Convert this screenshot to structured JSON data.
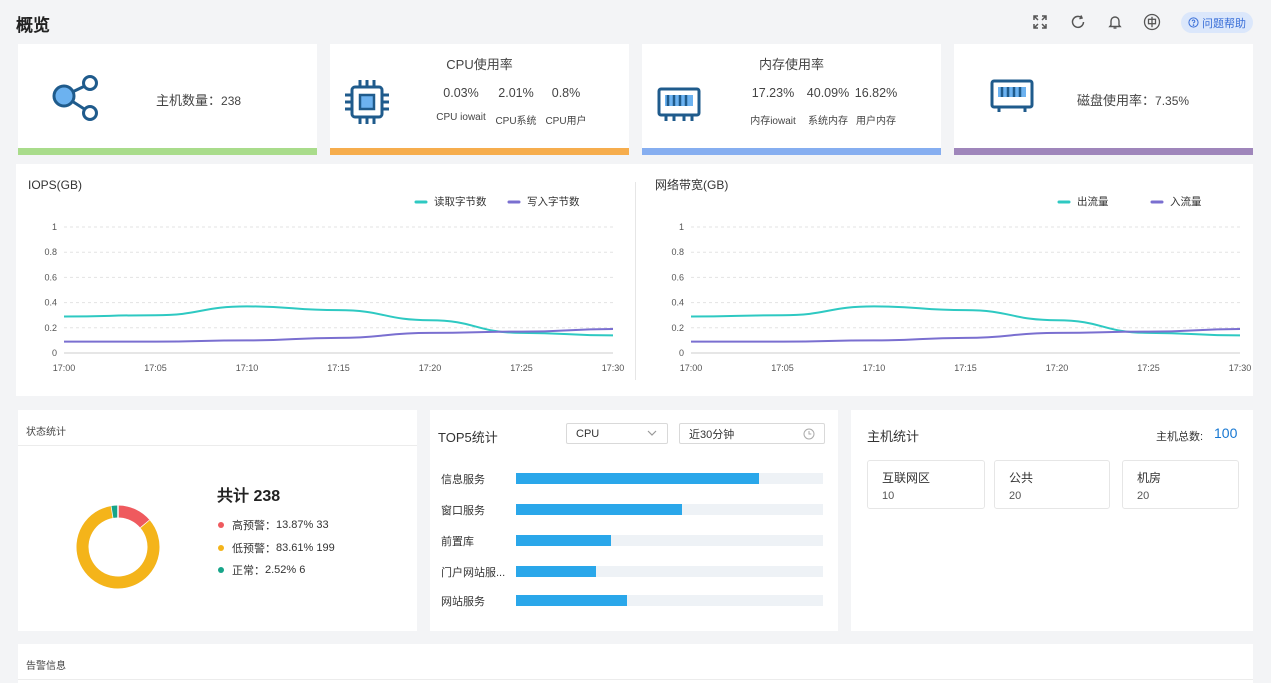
{
  "header": {
    "title": "概览",
    "icons": [
      "fullscreen-icon",
      "refresh-icon",
      "bell-icon",
      "language-icon"
    ],
    "help_label": "问题帮助"
  },
  "stat_cards": {
    "hosts": {
      "label": "主机数量：",
      "value": "238",
      "icon": "share-nodes-icon",
      "color": "#a9dc8b"
    },
    "cpu": {
      "title": "CPU使用率",
      "icon": "cpu-chip-icon",
      "color": "#f6ad4d",
      "metrics": [
        {
          "value": "0.03%",
          "label": "CPU iowait"
        },
        {
          "value": "2.01%",
          "label": "CPU系统"
        },
        {
          "value": "0.8%",
          "label": "CPU用户"
        }
      ]
    },
    "memory": {
      "title": "内存使用率",
      "icon": "memory-icon",
      "color": "#86aef0",
      "metrics": [
        {
          "value": "17.23%",
          "label": "内存iowait"
        },
        {
          "value": "40.09%",
          "label": "系统内存"
        },
        {
          "value": "16.82%",
          "label": "用户内存"
        }
      ]
    },
    "disk": {
      "label": "磁盘使用率：",
      "value": "7.35%",
      "icon": "disk-icon",
      "color": "#9f86bb"
    }
  },
  "colors": {
    "teal": "#2ec9c2",
    "purple": "#7a6fd0",
    "icon_blue": "#1f5b8c",
    "accent_blue": "#1677d2"
  },
  "chart_data": [
    {
      "type": "line",
      "title": "IOPS(GB)",
      "x": [
        "17:00",
        "17:05",
        "17:10",
        "17:15",
        "17:20",
        "17:25",
        "17:30"
      ],
      "ylim": [
        0,
        1
      ],
      "yticks": [
        "0",
        "0.2",
        "0.4",
        "0.6",
        "0.8",
        "1"
      ],
      "grid": true,
      "legend": "top-right",
      "series": [
        {
          "name": "读取字节数",
          "color": "#2ec9c2",
          "values": [
            0.29,
            0.3,
            0.37,
            0.34,
            0.26,
            0.16,
            0.14
          ]
        },
        {
          "name": "写入字节数",
          "color": "#7a6fd0",
          "values": [
            0.09,
            0.09,
            0.1,
            0.12,
            0.16,
            0.17,
            0.19
          ]
        }
      ]
    },
    {
      "type": "line",
      "title": "网络带宽(GB)",
      "x": [
        "17:00",
        "17:05",
        "17:10",
        "17:15",
        "17:20",
        "17:25",
        "17:30"
      ],
      "ylim": [
        0,
        1
      ],
      "yticks": [
        "0",
        "0.2",
        "0.4",
        "0.6",
        "0.8",
        "1"
      ],
      "grid": true,
      "legend": "top-right",
      "series": [
        {
          "name": "出流量",
          "color": "#2ec9c2",
          "values": [
            0.29,
            0.3,
            0.37,
            0.34,
            0.26,
            0.16,
            0.14
          ]
        },
        {
          "name": "入流量",
          "color": "#7a6fd0",
          "values": [
            0.09,
            0.09,
            0.1,
            0.12,
            0.16,
            0.17,
            0.19
          ]
        }
      ]
    },
    {
      "type": "pie",
      "title": "状态统计",
      "total_label": "共计 238",
      "slices": [
        {
          "name": "高预警",
          "percent": "13.87%",
          "count": 33,
          "value": 13.87,
          "color": "#ef5a5e"
        },
        {
          "name": "低预警",
          "percent": "83.61%",
          "count": 199,
          "value": 83.61,
          "color": "#f4b41a"
        },
        {
          "name": "正常",
          "percent": "2.52%",
          "count": 6,
          "value": 2.52,
          "color": "#17a589"
        }
      ]
    },
    {
      "type": "bar",
      "title": "TOP5统计",
      "categories": [
        "信息服务",
        "窗口服务",
        "前置库",
        "门户网站服...",
        "网站服务"
      ],
      "values": [
        0.79,
        0.54,
        0.31,
        0.26,
        0.36
      ],
      "color": "#2aa7ea"
    }
  ],
  "top5": {
    "metric_select": "CPU",
    "time_select": "近30分钟"
  },
  "host_stats": {
    "title": "主机统计",
    "total_label": "主机总数:",
    "total_value": "100",
    "groups": [
      {
        "name": "互联网区",
        "count": "10"
      },
      {
        "name": "公共",
        "count": "20"
      },
      {
        "name": "机房",
        "count": "20"
      }
    ]
  },
  "alerts": {
    "title": "告警信息"
  }
}
